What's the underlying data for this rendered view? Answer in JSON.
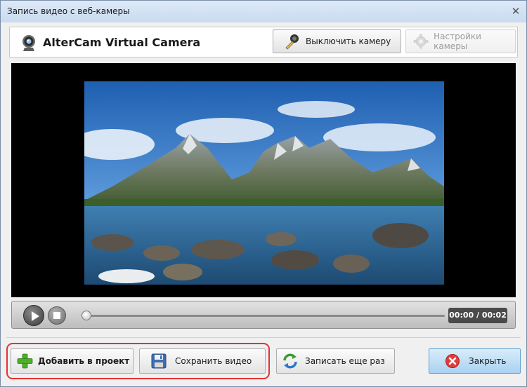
{
  "window": {
    "title": "Запись видео с веб-камеры",
    "close_glyph": "✕"
  },
  "header": {
    "camera_name": "AlterCam Virtual Camera",
    "camera_icon": "webcam-icon",
    "turn_off_button": {
      "label": "Выключить камеру",
      "icon": "webcam-off-icon"
    },
    "settings_button": {
      "label": "Настройки камеры",
      "icon": "gear-icon",
      "disabled": true
    }
  },
  "video": {
    "preview": "mountain-lake-preview",
    "time": "00:00 / 00:02",
    "progress": 0
  },
  "footer": {
    "add_button": {
      "label": "Добавить в проект",
      "icon": "plus-icon"
    },
    "save_button": {
      "label": "Сохранить видео",
      "icon": "floppy-disk-icon"
    },
    "record_again_button": {
      "label": "Записать еще раз",
      "icon": "refresh-icon"
    },
    "close_button": {
      "label": "Закрыть",
      "icon": "close-circle-icon"
    }
  },
  "colors": {
    "highlight": "#e53232",
    "close_button_bg": "#a9d2f1",
    "video_bg": "#000000",
    "time_badge": "#4a4a4a"
  }
}
